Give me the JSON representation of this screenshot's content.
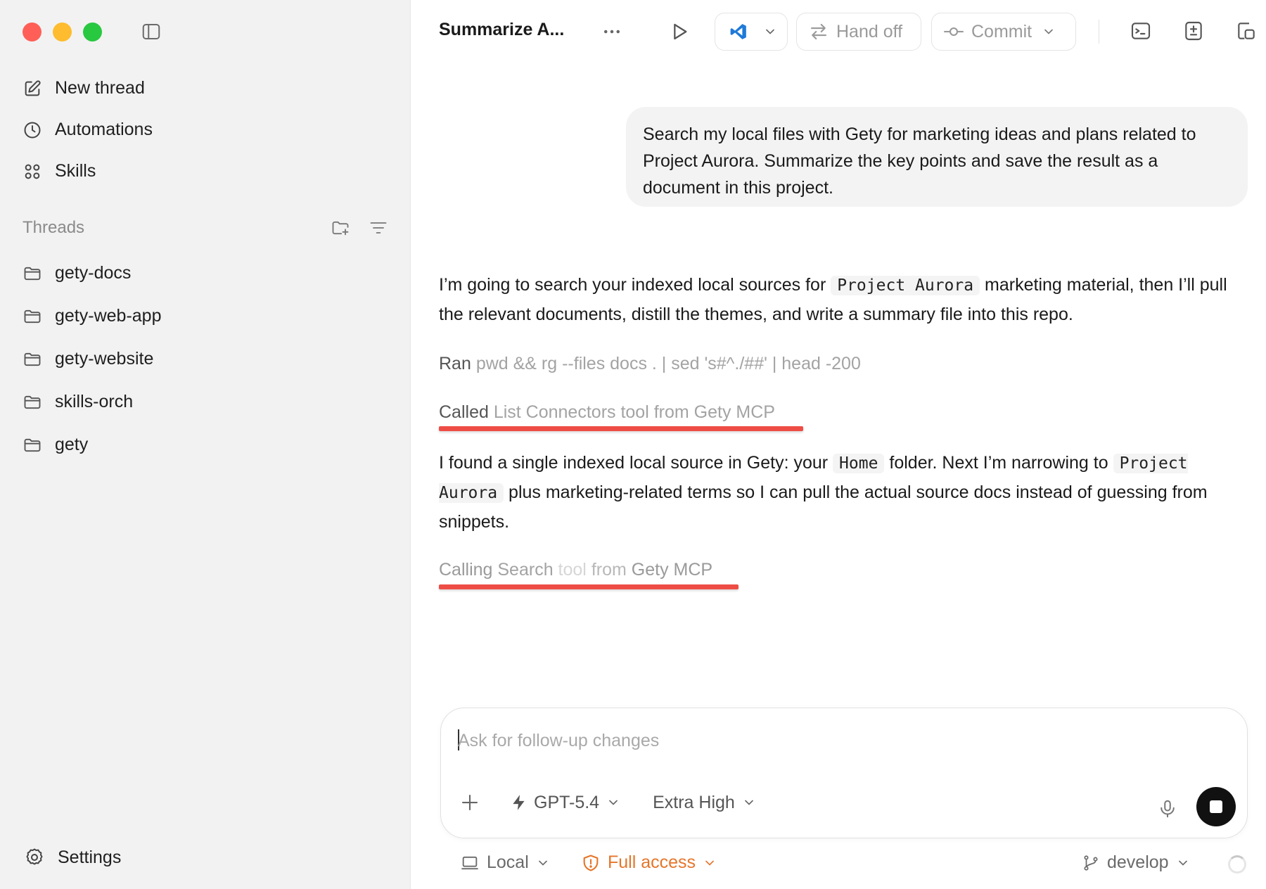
{
  "window": {
    "controls": [
      "close",
      "minimize",
      "zoom"
    ]
  },
  "sidebar": {
    "nav": [
      {
        "label": "New thread",
        "icon": "compose-icon"
      },
      {
        "label": "Automations",
        "icon": "clock-icon"
      },
      {
        "label": "Skills",
        "icon": "grid-icon"
      }
    ],
    "threads_label": "Threads",
    "threads": [
      {
        "label": "gety-docs"
      },
      {
        "label": "gety-web-app"
      },
      {
        "label": "gety-website"
      },
      {
        "label": "skills-orch"
      },
      {
        "label": "gety"
      }
    ],
    "settings_label": "Settings"
  },
  "topbar": {
    "title": "Summarize A...",
    "handoff_label": "Hand off",
    "commit_label": "Commit"
  },
  "conversation": {
    "user_message": "Search my local files with Gety for marketing ideas and plans related to Project Aurora. Summarize the key points and save the result as a document in this project.",
    "assistant_1": {
      "before": "I’m going to search your indexed local sources for ",
      "code": "Project Aurora",
      "after": " marketing material, then I’ll pull the relevant documents, distill the themes, and write a summary file into this repo."
    },
    "step_ran": {
      "verb": "Ran",
      "detail": " pwd && rg --files docs . | sed 's#^./##' | head -200"
    },
    "step_called": {
      "verb": "Called",
      "detail": " List Connectors tool from Gety MCP"
    },
    "assistant_2": {
      "p1": "I found a single indexed local source in Gety: your ",
      "code1": "Home",
      "p2": " folder. Next I’m narrowing to ",
      "code2": "Project Aurora",
      "p3": " plus marketing-related terms so I can pull the actual source docs instead of guessing from snippets."
    },
    "step_calling": {
      "verb": "Calling",
      "part1": " Search",
      "part2": " tool",
      "part3": " from",
      "part4": " Gety MCP"
    }
  },
  "composer": {
    "placeholder": "Ask for follow-up changes",
    "model": "GPT-5.4",
    "effort": "Extra High"
  },
  "footer": {
    "environment": "Local",
    "access": "Full access",
    "branch": "develop"
  },
  "colors": {
    "accent_red": "#ee4d45",
    "access_orange": "#e5762a",
    "sidebar_bg": "#f2f2f2"
  }
}
